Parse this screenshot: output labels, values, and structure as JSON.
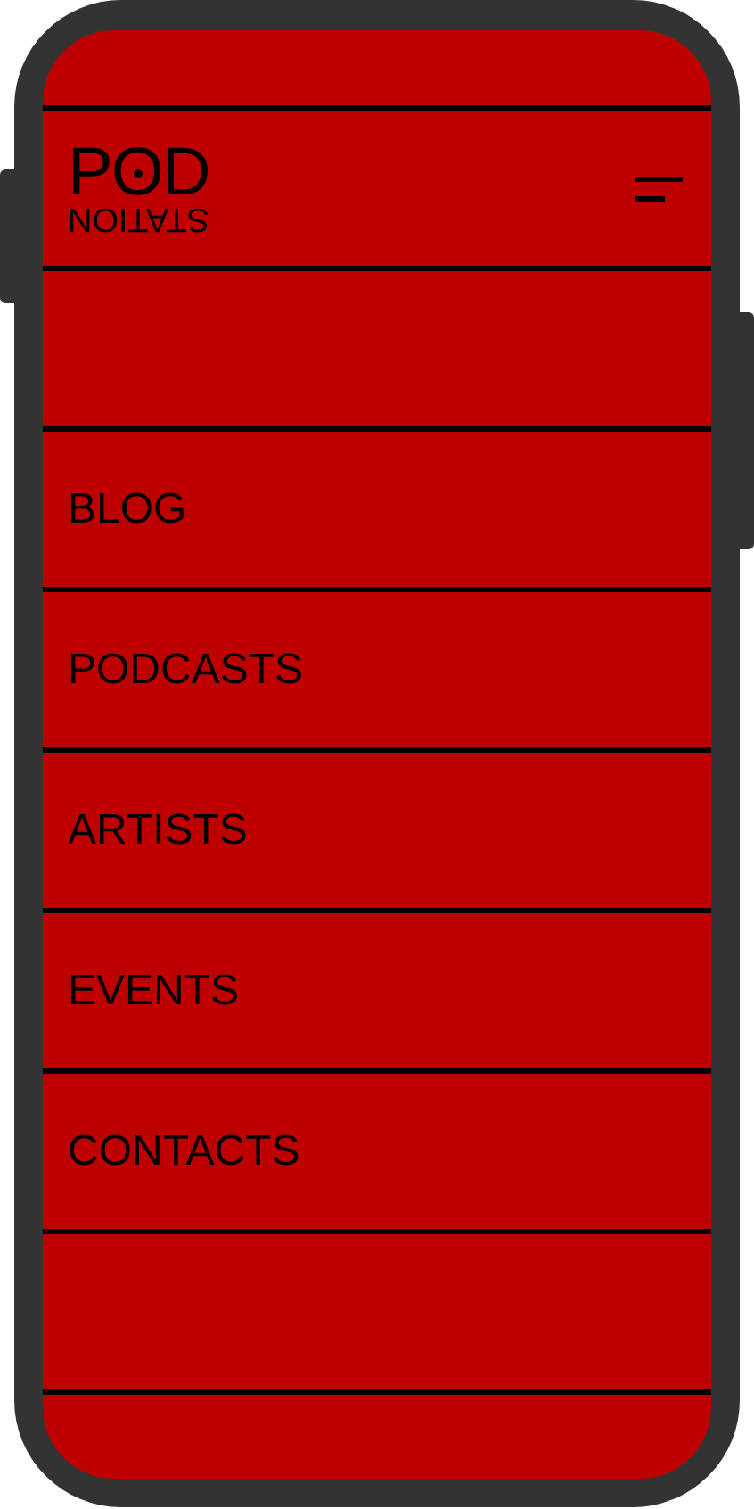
{
  "logo": {
    "top": "POD",
    "bottom": "STATION"
  },
  "menu": [
    {
      "label": "BLOG"
    },
    {
      "label": "PODCASTS"
    },
    {
      "label": "ARTISTS"
    },
    {
      "label": "EVENTS"
    },
    {
      "label": "CONTACTS"
    }
  ]
}
